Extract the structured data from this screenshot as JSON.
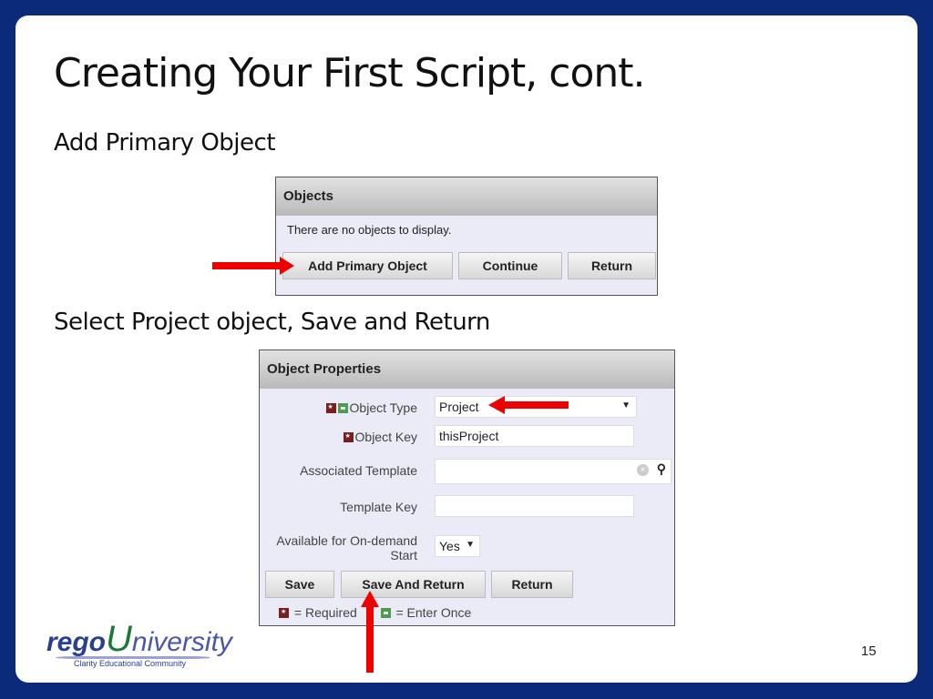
{
  "slide": {
    "title": "Creating Your First Script, cont.",
    "step1": "Add Primary Object",
    "step2": "Select Project object, Save and Return",
    "page_number": "15"
  },
  "objects_panel": {
    "header": "Objects",
    "empty_message": "There are no objects to display.",
    "buttons": [
      "Add Primary Object",
      "Continue",
      "Return"
    ]
  },
  "properties_panel": {
    "header": "Object Properties",
    "fields": {
      "object_type": {
        "label": "Object Type",
        "value": "Project"
      },
      "object_key": {
        "label": "Object Key",
        "value": "thisProject"
      },
      "associated_template": {
        "label": "Associated Template",
        "value": ""
      },
      "template_key": {
        "label": "Template Key",
        "value": ""
      },
      "on_demand": {
        "label_line1": "Available for On-demand",
        "label_line2": "Start",
        "value": "Yes"
      }
    },
    "buttons": [
      "Save",
      "Save And Return",
      "Return"
    ],
    "legend": {
      "required": "= Required",
      "enter_once": "= Enter Once"
    }
  },
  "logo": {
    "brand_prefix": "rego",
    "brand_u": "U",
    "brand_suffix": "niversity",
    "tagline": "Clarity Educational Community"
  },
  "colors": {
    "frame": "#0b2a7a",
    "arrow": "#ee0000",
    "required": "#7a1f1f",
    "enter_once": "#4f9a4f",
    "logo_blue": "#2a3f8f",
    "logo_green": "#1b7a3a"
  }
}
